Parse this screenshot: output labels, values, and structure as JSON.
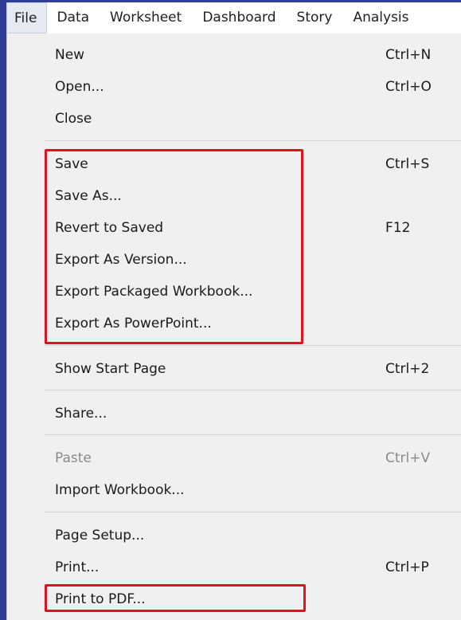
{
  "menubar": {
    "items": [
      "File",
      "Data",
      "Worksheet",
      "Dashboard",
      "Story",
      "Analysis"
    ]
  },
  "file_menu": {
    "new": {
      "label": "New",
      "shortcut": "Ctrl+N"
    },
    "open": {
      "label": "Open...",
      "shortcut": "Ctrl+O"
    },
    "close": {
      "label": "Close"
    },
    "save": {
      "label": "Save",
      "shortcut": "Ctrl+S"
    },
    "save_as": {
      "label": "Save As..."
    },
    "revert": {
      "label": "Revert to Saved",
      "shortcut": "F12"
    },
    "export_version": {
      "label": "Export As Version..."
    },
    "export_packaged": {
      "label": "Export Packaged Workbook..."
    },
    "export_ppt": {
      "label": "Export As PowerPoint..."
    },
    "show_start": {
      "label": "Show Start Page",
      "shortcut": "Ctrl+2"
    },
    "share": {
      "label": "Share..."
    },
    "paste": {
      "label": "Paste",
      "shortcut": "Ctrl+V"
    },
    "import": {
      "label": "Import Workbook..."
    },
    "page_setup": {
      "label": "Page Setup..."
    },
    "print": {
      "label": "Print...",
      "shortcut": "Ctrl+P"
    },
    "print_pdf": {
      "label": "Print to PDF..."
    }
  },
  "colors": {
    "highlight": "#e0141e",
    "background": "#2f3d96",
    "menu": "#f0f0f0"
  }
}
